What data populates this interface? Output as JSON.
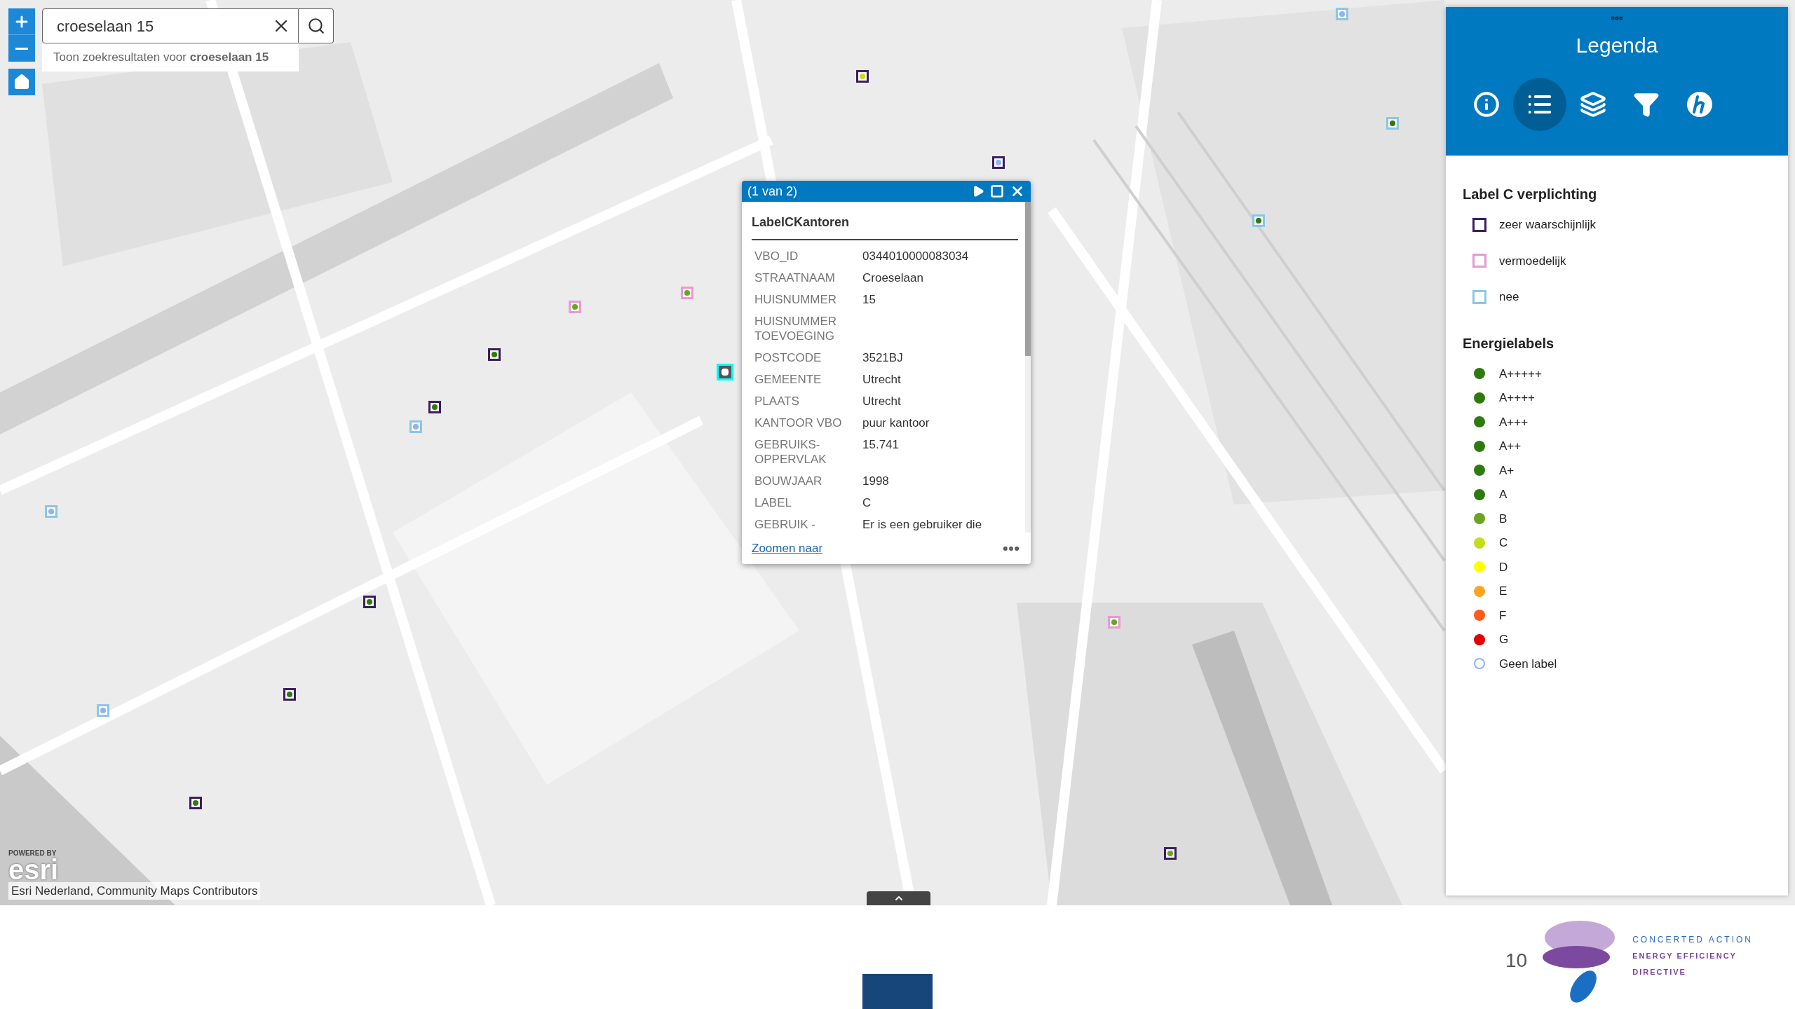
{
  "search": {
    "value": "croeselaan 15",
    "suggestion": "Toon zoekresultaten voor **croeselaan 15**"
  },
  "popup": {
    "pager": "(1 van 2)",
    "layer_title": "LabelCKantoren",
    "fields": [
      {
        "label": "VBO_ID",
        "value": "0344010000083034"
      },
      {
        "label": "STRAATNAAM",
        "value": "Croeselaan"
      },
      {
        "label": "HUISNUMMER",
        "value": "15"
      },
      {
        "label": "HUISNUMMER TOEVOEGING"
      },
      {
        "label": "POSTCODE",
        "value": "3521BJ"
      },
      {
        "label": "GEMEENTE",
        "value": "Utrecht"
      },
      {
        "label": "PLAATS",
        "value": "Utrecht"
      },
      {
        "label": "KANTOOR VBO",
        "value": "puur kantoor"
      },
      {
        "label": "GEBRUIKS-OPPERVLAK",
        "value": "15.741"
      },
      {
        "label": "BOUWJAAR",
        "value": "1998"
      },
      {
        "label": "LABEL",
        "value": "C"
      },
      {
        "label": "GEBRUIK -",
        "value": "Er is een gebruiker die"
      }
    ],
    "link": "Zoomen naar"
  },
  "legend": {
    "title": "Legenda",
    "tabs": [
      {
        "kind": "info",
        "selected": false
      },
      {
        "kind": "list",
        "selected": true
      },
      {
        "kind": "layers",
        "selected": false
      },
      {
        "kind": "filter",
        "selected": false
      },
      {
        "kind": "help",
        "selected": false
      }
    ],
    "sections": [
      {
        "title": "Label C verplichting",
        "items": [
          {
            "kind": "square",
            "color": "#3b1f5c",
            "label": "zeer waarschijnlijk"
          },
          {
            "kind": "square",
            "color": "#e89ad0",
            "label": "vermoedelijk"
          },
          {
            "kind": "square",
            "color": "#8cc6e6",
            "label": "nee"
          }
        ]
      },
      {
        "title": "Energielabels",
        "items": [
          {
            "kind": "dot",
            "color": "#2f7a0f",
            "label": "A+++++"
          },
          {
            "kind": "dot",
            "color": "#2f7a0f",
            "label": "A++++"
          },
          {
            "kind": "dot",
            "color": "#2f7a0f",
            "label": "A+++"
          },
          {
            "kind": "dot",
            "color": "#2f7a0f",
            "label": "A++"
          },
          {
            "kind": "dot",
            "color": "#2f7a0f",
            "label": "A+"
          },
          {
            "kind": "dot",
            "color": "#2f7a0f",
            "label": "A"
          },
          {
            "kind": "dot",
            "color": "#6aa51c",
            "label": "B"
          },
          {
            "kind": "dot",
            "color": "#c5dc1a",
            "label": "C"
          },
          {
            "kind": "dot",
            "color": "#ffff00",
            "label": "D"
          },
          {
            "kind": "dot",
            "color": "#ffa41c",
            "label": "E"
          },
          {
            "kind": "dot",
            "color": "#ff5a1a",
            "label": "F"
          },
          {
            "kind": "dot",
            "color": "#e60000",
            "label": "G"
          },
          {
            "kind": "ring",
            "color": "#8fb3f0",
            "label": "Geen label"
          }
        ]
      }
    ]
  },
  "esri_logo": {
    "caption": "POWERED BY",
    "name": "esri"
  },
  "attribution": "Esri Nederland, Community Maps Contributors",
  "slide": {
    "page_number": "10",
    "logo_lines": [
      "CONCERTED ACTION",
      "ENERGY EFFICIENCY",
      "DIRECTIVE"
    ]
  }
}
